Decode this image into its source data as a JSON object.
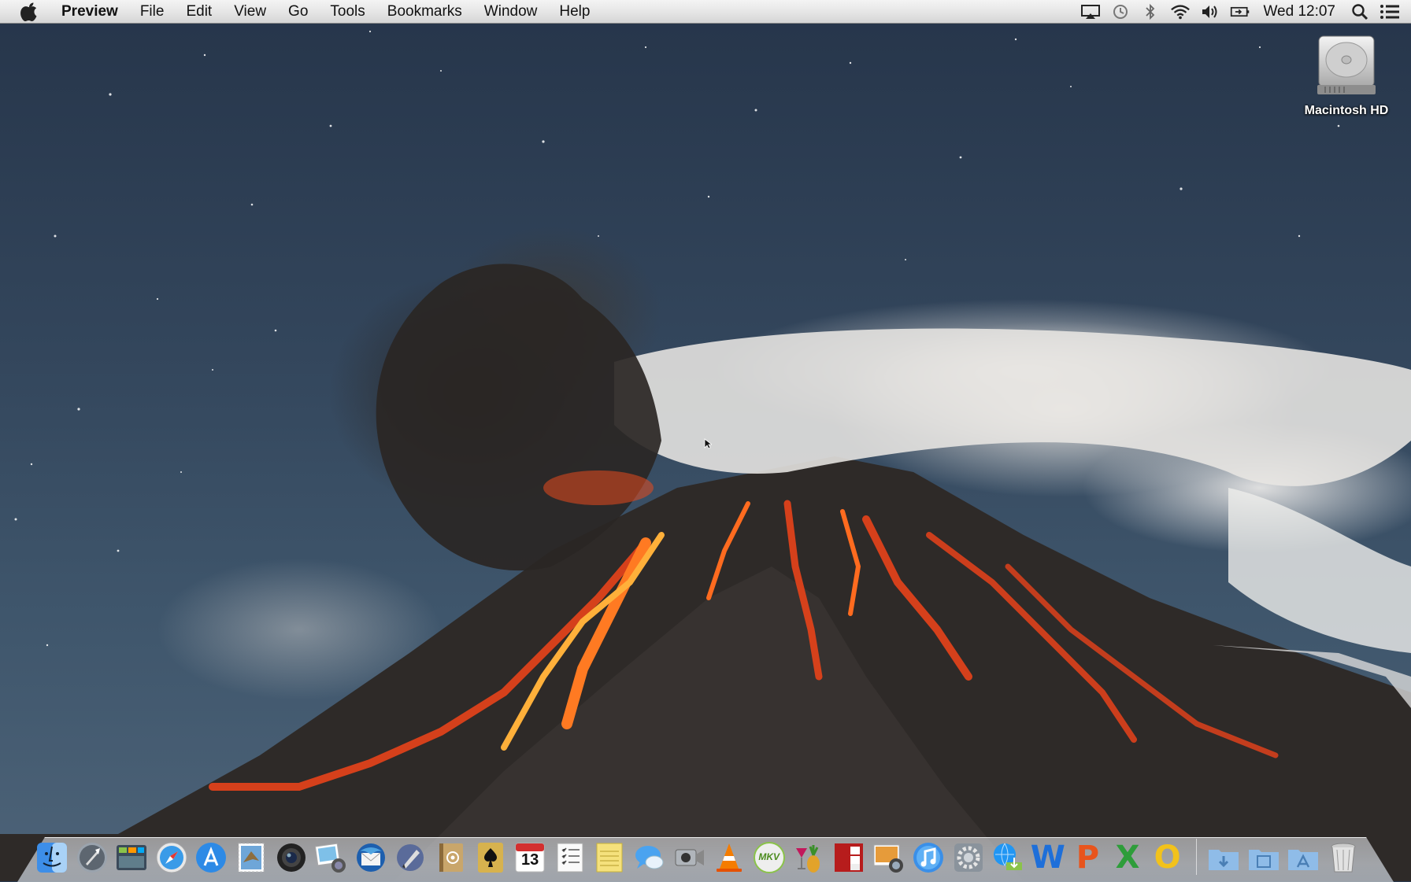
{
  "menubar": {
    "app_name": "Preview",
    "menus": [
      "File",
      "Edit",
      "View",
      "Go",
      "Tools",
      "Bookmarks",
      "Window",
      "Help"
    ],
    "status_icons": [
      "airplay-icon",
      "time-machine-icon",
      "bluetooth-icon",
      "wifi-icon",
      "volume-icon",
      "battery-icon"
    ],
    "clock": "Wed 12:07"
  },
  "desktop": {
    "icons": [
      {
        "label": "Macintosh HD",
        "icon": "hard-drive-icon"
      }
    ]
  },
  "dock": {
    "calendar_date": "13",
    "apps": [
      "finder",
      "launchpad",
      "mission-control",
      "safari",
      "app-store",
      "mail-stamp",
      "facetime-camera",
      "iphoto",
      "thunderbird",
      "pen-tool",
      "address-book",
      "solitaire",
      "calendar",
      "reminders",
      "notes",
      "messages",
      "facetime",
      "vlc",
      "mkv",
      "cocktail",
      "photo-booth",
      "image-capture",
      "itunes",
      "system-preferences",
      "network-utility",
      "word",
      "powerpoint",
      "excel",
      "outlook"
    ],
    "mkv_label": "MKV",
    "word_letter": "W",
    "powerpoint_letter": "P",
    "excel_letter": "X",
    "outlook_letter": "O",
    "stacks": [
      "downloads-stack",
      "documents-stack",
      "applications-stack",
      "trash"
    ]
  },
  "colors": {
    "menubar_bg": "#e3e3e3",
    "sky": "#33465c",
    "lava": "#e8421a"
  }
}
